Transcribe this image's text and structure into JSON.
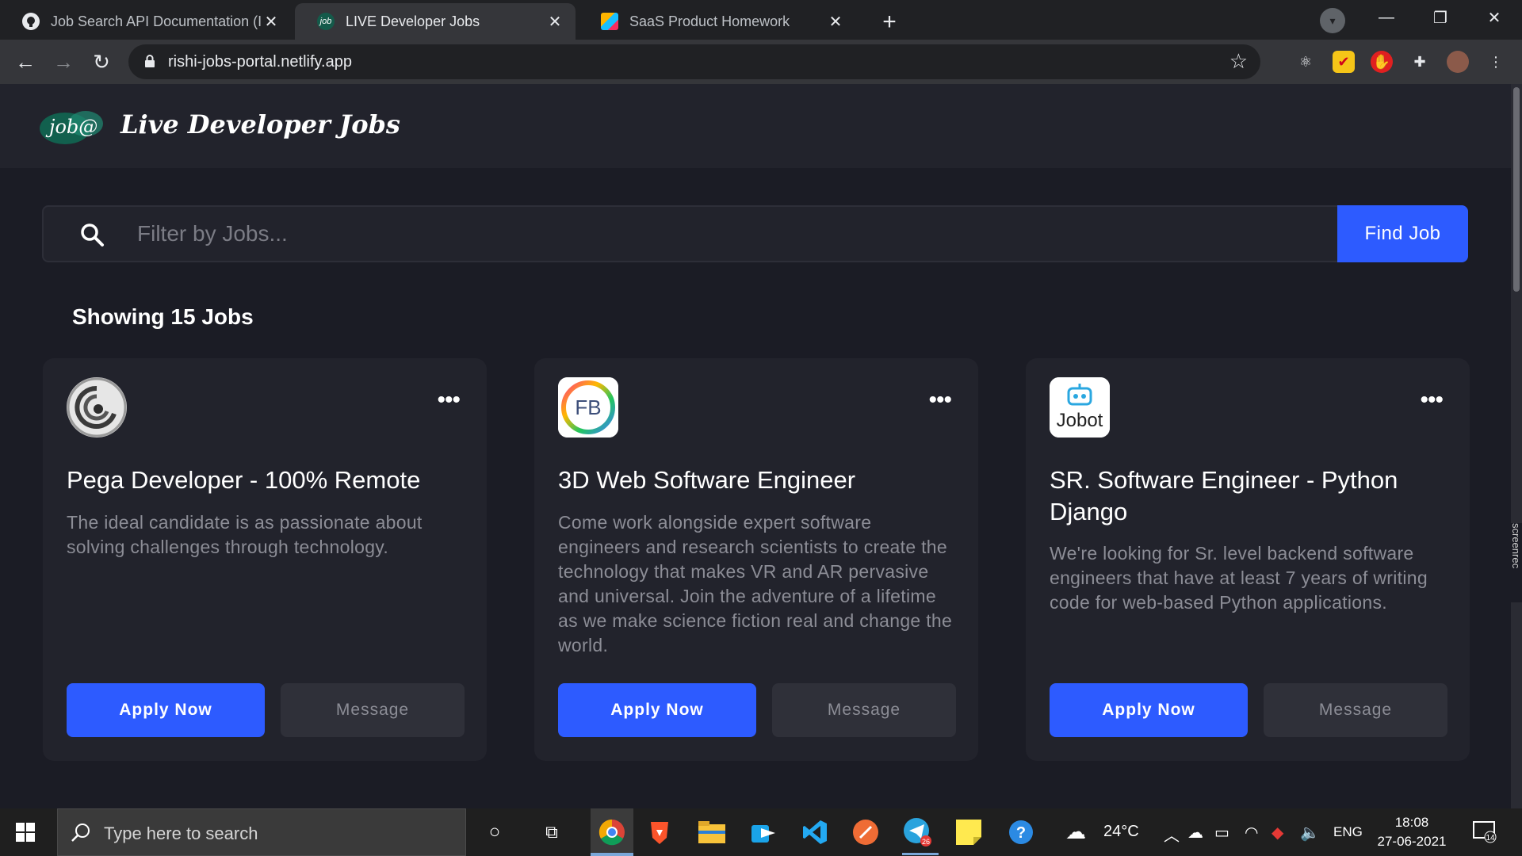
{
  "browser": {
    "tabs": [
      {
        "title": "Job Search API Documentation (I",
        "icon": "github-octocat-icon",
        "active": false
      },
      {
        "title": "LIVE Developer Jobs",
        "icon": "job-logo-icon",
        "active": true
      },
      {
        "title": "SaaS Product Homework",
        "icon": "airtable-icon",
        "active": false
      }
    ],
    "new_tab": "+",
    "url": "rishi-jobs-portal.netlify.app"
  },
  "site": {
    "logo_text": "job@",
    "title": "Live Developer Jobs",
    "brand_color": "#2d5bff"
  },
  "search": {
    "placeholder": "Filter by Jobs...",
    "value": "",
    "button_label": "Find Job"
  },
  "results": {
    "summary": "Showing 15 Jobs"
  },
  "jobs": [
    {
      "company_logo": "pega-swirl-logo",
      "title": "Pega Developer - 100% Remote",
      "description": "The ideal candidate is as passionate about solving challenges through technology.",
      "apply_label": "Apply Now",
      "message_label": "Message",
      "more_label": "•••"
    },
    {
      "company_logo": "fb-ring-logo",
      "logo_text": "FB",
      "title": "3D Web Software Engineer",
      "description": "Come work alongside expert software engineers and research scientists to create the technology that makes VR and AR pervasive and universal. Join the adventure of a lifetime as we make science fiction real and change the world.",
      "apply_label": "Apply Now",
      "message_label": "Message",
      "more_label": "•••"
    },
    {
      "company_logo": "jobot-robot-logo",
      "logo_text": "Jobot",
      "title": "SR. Software Engineer - Python Django",
      "description": "We're looking for Sr. level backend software engineers that have at least 7 years of writing code for web-based Python applications.",
      "apply_label": "Apply Now",
      "message_label": "Message",
      "more_label": "•••"
    }
  ],
  "overlay": {
    "recorder_label": "screenrec"
  },
  "taskbar": {
    "search_placeholder": "Type here to search",
    "weather": "24°C",
    "language": "ENG",
    "time": "18:08",
    "date": "27-06-2021",
    "notification_count": "14",
    "telegram_badge": "26"
  }
}
